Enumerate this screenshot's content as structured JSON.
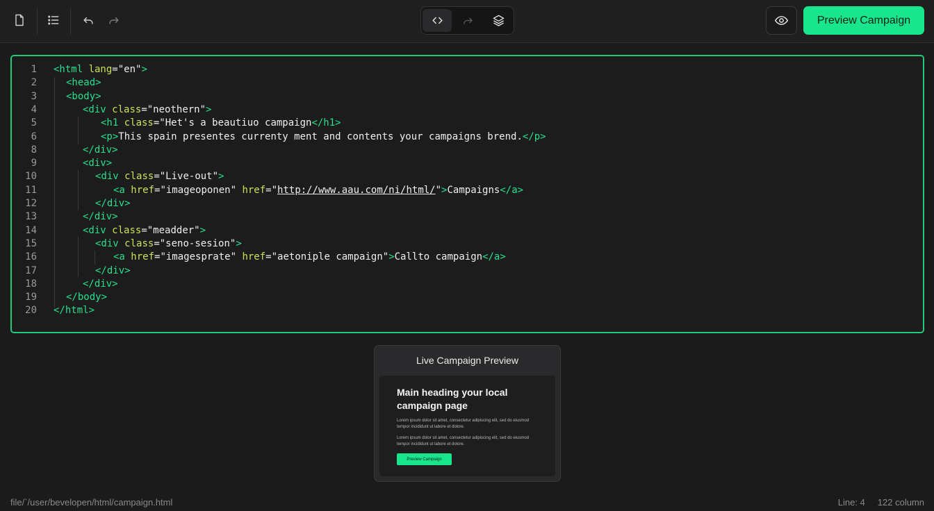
{
  "toolbar": {
    "icons": {
      "new_file": "file-icon",
      "outline": "list-icon",
      "undo": "undo-icon",
      "redo": "redo-icon",
      "code_view": "code-icon",
      "split_view": "redo-disabled-icon",
      "layers": "layers-icon",
      "preview_toggle": "eye-icon"
    },
    "preview_button_label": "Preview Campaign",
    "accent_color": "#19e68c"
  },
  "editor": {
    "border_color": "#1fc97e",
    "lines": [
      {
        "n": "1",
        "tokens": [
          [
            "t",
            "<html "
          ],
          [
            "a",
            "lang"
          ],
          [
            "s",
            "=\"en\""
          ],
          [
            "t",
            ">"
          ]
        ]
      },
      {
        "n": "2",
        "tokens": [
          [
            "t",
            "<head>"
          ]
        ]
      },
      {
        "n": "3",
        "tokens": [
          [
            "t",
            "<body>"
          ]
        ]
      },
      {
        "n": "4",
        "tokens": [
          [
            "t",
            "<div "
          ],
          [
            "a",
            "class"
          ],
          [
            "s",
            "=\"neothern\""
          ],
          [
            "t",
            ">"
          ]
        ]
      },
      {
        "n": "5",
        "tokens": [
          [
            "t",
            "<h1 "
          ],
          [
            "a",
            "class"
          ],
          [
            "s",
            "=\"Het's a beautiuo campaign"
          ],
          [
            "t",
            "</h1>"
          ]
        ]
      },
      {
        "n": "6",
        "tokens": [
          [
            "t",
            "<p>"
          ],
          [
            "s",
            "This spain presentes currenty ment and contents your campaigns brend."
          ],
          [
            "t",
            "</p>"
          ]
        ]
      },
      {
        "n": "8",
        "tokens": [
          [
            "t",
            "</div>"
          ]
        ]
      },
      {
        "n": "9",
        "tokens": [
          [
            "t",
            "<div>"
          ]
        ]
      },
      {
        "n": "10",
        "tokens": [
          [
            "t",
            "<div "
          ],
          [
            "a",
            "class"
          ],
          [
            "s",
            "=\"Live-out\""
          ],
          [
            "t",
            ">"
          ]
        ]
      },
      {
        "n": "11",
        "tokens": [
          [
            "t",
            "<a "
          ],
          [
            "a",
            "href"
          ],
          [
            "s",
            "=\"imageoponen\" "
          ],
          [
            "a",
            "href"
          ],
          [
            "s",
            "=\""
          ],
          [
            "u",
            "http://www.aau.com/ni/html/"
          ],
          [
            "s",
            "\""
          ],
          [
            "t",
            ">"
          ],
          [
            "s",
            "Campaigns"
          ],
          [
            "t",
            "</a>"
          ]
        ]
      },
      {
        "n": "12",
        "tokens": [
          [
            "t",
            "</div>"
          ]
        ]
      },
      {
        "n": "13",
        "tokens": [
          [
            "t",
            "</div>"
          ]
        ]
      },
      {
        "n": "14",
        "tokens": [
          [
            "t",
            "<div "
          ],
          [
            "a",
            "class"
          ],
          [
            "s",
            "=\"meadder\""
          ],
          [
            "t",
            ">"
          ]
        ]
      },
      {
        "n": "15",
        "tokens": [
          [
            "t",
            "<div "
          ],
          [
            "a",
            "class"
          ],
          [
            "s",
            "=\"seno-sesion\""
          ],
          [
            "t",
            ">"
          ]
        ]
      },
      {
        "n": "16",
        "tokens": [
          [
            "t",
            "<a "
          ],
          [
            "a",
            "href"
          ],
          [
            "s",
            "=\"imagesprate\" "
          ],
          [
            "a",
            "href"
          ],
          [
            "s",
            "=\"aetoniple campaign\""
          ],
          [
            "t",
            ">"
          ],
          [
            "s",
            "Callto campaign"
          ],
          [
            "t",
            "</a>"
          ]
        ]
      },
      {
        "n": "17",
        "tokens": [
          [
            "t",
            "</div>"
          ]
        ]
      },
      {
        "n": "18",
        "tokens": [
          [
            "t",
            "</div>"
          ]
        ]
      },
      {
        "n": "19",
        "tokens": [
          [
            "t",
            "</body>"
          ]
        ]
      },
      {
        "n": "20",
        "tokens": [
          [
            "t",
            "</html>"
          ]
        ]
      }
    ]
  },
  "preview": {
    "title": "Live Campaign Preview",
    "heading": "Main heading your local campaign page",
    "paragraph_1": "Lorem ipsum dolor sit amet, consectetur adipiscing elit, sed do eiusmod tempor incididunt ut labore et dolore.",
    "paragraph_2": "Lorem ipsum dolor sit amet, consectetur adipiscing elit, sed do eiusmod tempor incididunt ut labore et dolore.",
    "button_label": "Preview Campaign"
  },
  "status": {
    "file_path": "file/`/user/bevelopen/html/campaign.html",
    "line": "Line: 4",
    "column": "122 column"
  }
}
